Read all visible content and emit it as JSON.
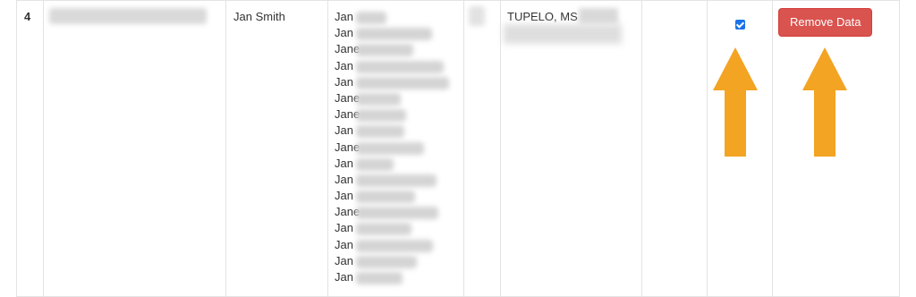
{
  "row": {
    "number": "4",
    "owner_name": "Jan Smith",
    "aliases": [
      "Jan",
      "Jan",
      "Jane",
      "Jan",
      "Jan",
      "Jane",
      "Jane",
      "Jan",
      "Jane",
      "Jan",
      "Jan",
      "Jan",
      "Jane",
      "Jan",
      "Jan",
      "Jan",
      "Jan"
    ],
    "location": "TUPELO, MS",
    "keep_checked": true,
    "remove_button_label": "Remove Data"
  },
  "colors": {
    "arrow": "#f2a422",
    "remove_button": "#d9534f",
    "checkbox": "#1a73e8"
  },
  "annotations": {
    "icons": [
      "arrow-up-icon",
      "arrow-up-icon"
    ]
  }
}
